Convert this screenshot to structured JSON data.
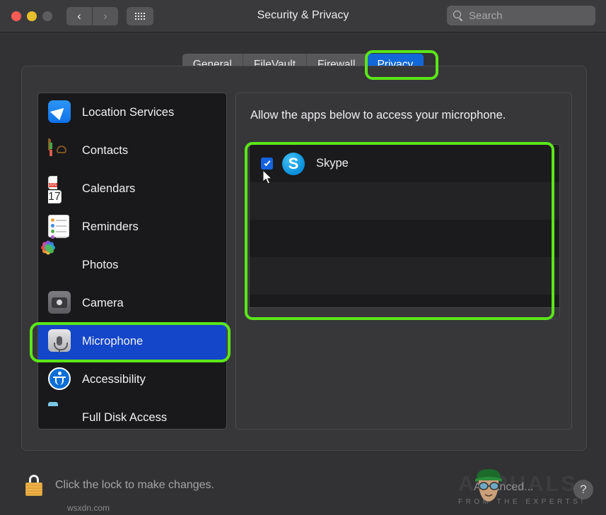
{
  "window": {
    "title": "Security & Privacy",
    "traffic_lights": [
      "close",
      "minimize",
      "zoom-disabled"
    ],
    "nav": {
      "back": "‹",
      "forward": "›",
      "show_all": "grid-icon"
    }
  },
  "search": {
    "placeholder": "Search",
    "value": ""
  },
  "tabs": [
    {
      "label": "General",
      "active": false
    },
    {
      "label": "FileVault",
      "active": false
    },
    {
      "label": "Firewall",
      "active": false
    },
    {
      "label": "Privacy",
      "active": true
    }
  ],
  "sidebar": {
    "items": [
      {
        "label": "Location Services",
        "icon": "location-services-icon",
        "selected": false
      },
      {
        "label": "Contacts",
        "icon": "contacts-icon",
        "selected": false
      },
      {
        "label": "Calendars",
        "icon": "calendars-icon",
        "selected": false
      },
      {
        "label": "Reminders",
        "icon": "reminders-icon",
        "selected": false
      },
      {
        "label": "Photos",
        "icon": "photos-icon",
        "selected": false
      },
      {
        "label": "Camera",
        "icon": "camera-icon",
        "selected": false
      },
      {
        "label": "Microphone",
        "icon": "microphone-icon",
        "selected": true
      },
      {
        "label": "Accessibility",
        "icon": "accessibility-icon",
        "selected": false
      },
      {
        "label": "Full Disk Access",
        "icon": "folder-icon",
        "selected": false
      }
    ],
    "calendar_icon": {
      "month": "JUL",
      "day": "17"
    }
  },
  "content": {
    "description": "Allow the apps below to access your microphone.",
    "apps": [
      {
        "name": "Skype",
        "checked": true,
        "icon": "skype-icon",
        "initial": "S"
      }
    ]
  },
  "footer": {
    "lock_text": "Click the lock to make changes.",
    "lock_icon": "padlock-unlocked-icon",
    "help_label": "?"
  },
  "annotations": {
    "color": "#5ce619",
    "targets": [
      "privacy-tab",
      "microphone-sidebar-item",
      "app-list"
    ]
  },
  "watermark": {
    "main": "APPUALS",
    "sub": "FROM THE EXPERTS!",
    "mid": "Advanced...",
    "url": "wsxdn.com"
  }
}
